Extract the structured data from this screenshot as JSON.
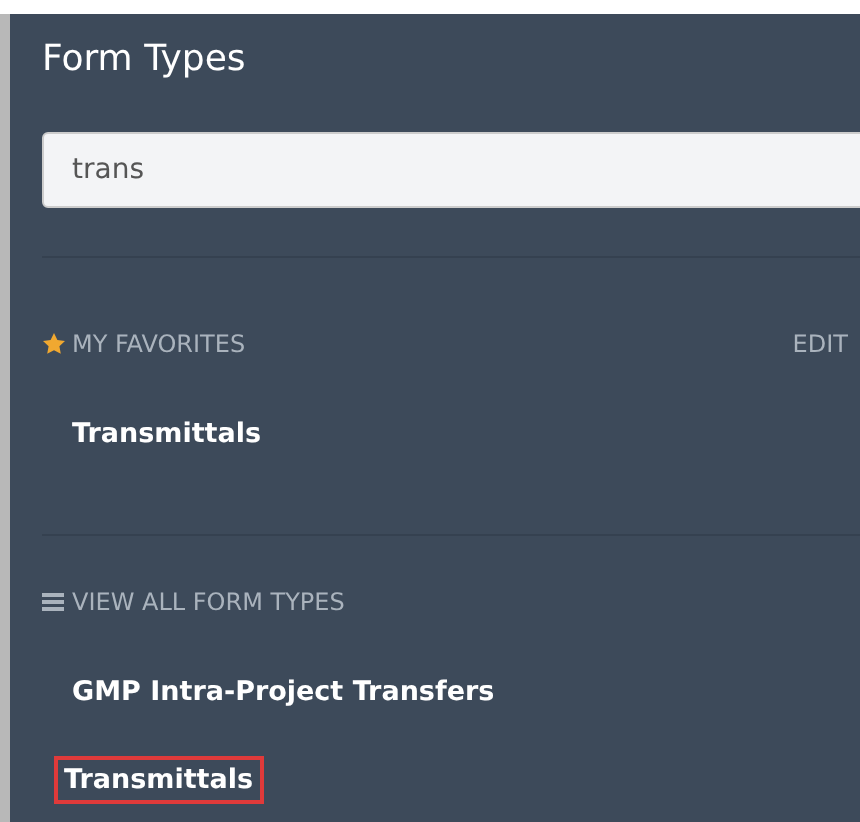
{
  "panel": {
    "title": "Form Types"
  },
  "search": {
    "value": "trans"
  },
  "favorites": {
    "heading": "MY FAVORITES",
    "edit": "EDIT",
    "items": [
      {
        "label": "Transmittals",
        "highlighted": false
      }
    ]
  },
  "all_types": {
    "heading": "VIEW ALL FORM TYPES",
    "items": [
      {
        "label": "GMP Intra-Project Transfers",
        "highlighted": false
      },
      {
        "label": "Transmittals",
        "highlighted": true
      }
    ]
  }
}
